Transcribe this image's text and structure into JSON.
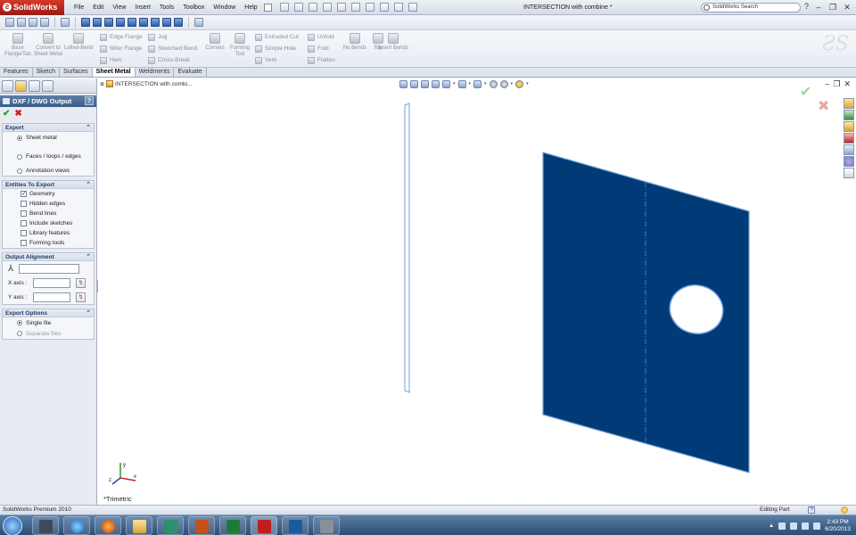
{
  "app": {
    "logo_text": "SolidWorks",
    "document_title": "INTERSECTION with combine *",
    "search_placeholder": "SolidWorks Search"
  },
  "menu": [
    "File",
    "Edit",
    "View",
    "Insert",
    "Tools",
    "Toolbox",
    "Window",
    "Help"
  ],
  "command_manager": {
    "base_flange": "Base Flange/Tab",
    "convert": "Convert to Sheet Metal",
    "lofted_bend": "Lofted-Bend",
    "edge_flange": "Edge Flange",
    "miter_flange": "Miter Flange",
    "hem": "Hem",
    "jog": "Jog",
    "sketched_bend": "Sketched Bend",
    "cross_break": "Cross-Break",
    "corners": "Corners",
    "forming_tool": "Forming Tool",
    "extruded_cut": "Extruded Cut",
    "simple_hole": "Simple Hole",
    "vent": "Vent",
    "unfold": "Unfold",
    "fold": "Fold",
    "flatten": "Flatten",
    "no_bends": "No Bends",
    "rip": "Rip",
    "insert_bends": "Insert Bends"
  },
  "tabs": [
    "Features",
    "Sketch",
    "Surfaces",
    "Sheet Metal",
    "Weldments",
    "Evaluate"
  ],
  "active_tab": "Sheet Metal",
  "property_manager": {
    "title": "DXF / DWG Output",
    "help": "?",
    "export": {
      "title": "Export",
      "options": [
        {
          "label": "Sheet metal",
          "selected": true
        },
        {
          "label": "Faces / loops / edges",
          "selected": false
        },
        {
          "label": "Annotation views",
          "selected": false
        }
      ]
    },
    "entities": {
      "title": "Entities To Export",
      "items": [
        {
          "label": "Geometry",
          "checked": true
        },
        {
          "label": "Hidden edges",
          "checked": false
        },
        {
          "label": "Bend lines",
          "checked": false
        },
        {
          "label": "Include sketches",
          "checked": false
        },
        {
          "label": "Library features",
          "checked": false
        },
        {
          "label": "Forming tools",
          "checked": false
        }
      ]
    },
    "alignment": {
      "title": "Output Alignment",
      "x_axis": "X axis :",
      "y_axis": "Y axis :",
      "x_value": "",
      "y_value": "",
      "origin_value": ""
    },
    "export_options": {
      "title": "Export Options",
      "single_file": "Single file",
      "separate_files": "Separate files"
    }
  },
  "graphics": {
    "tree_flyout": "INTERSECTION with combi...",
    "view_orientation": "*Trimetric",
    "triad": {
      "x": "x",
      "y": "y",
      "z": "z"
    },
    "part_color": "#003b78",
    "edge_color": "#6f9fd6"
  },
  "status": {
    "product": "SolidWorks Premium 2010",
    "mode": "Editing Part"
  },
  "taskbar": {
    "time": "2:43 PM",
    "date": "6/20/2013"
  }
}
